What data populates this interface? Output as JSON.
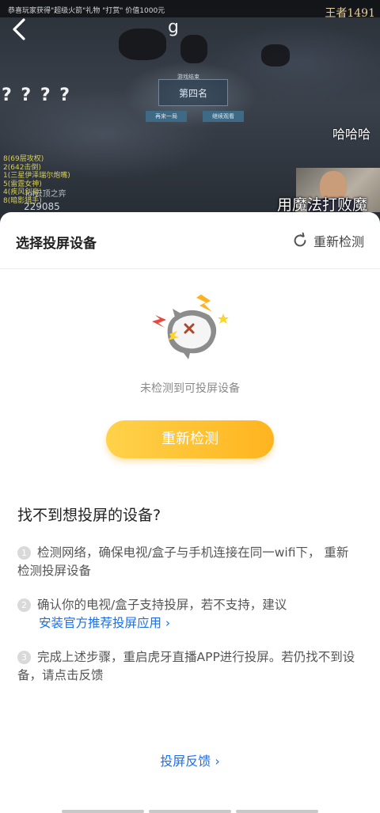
{
  "video": {
    "ticker": "恭喜玩家获得\"超级火箭\"礼物 \"打赏\" 价值1000元",
    "watermark": "王者1491",
    "back_icon": "chevron-left-icon",
    "letter": "g",
    "rank_sub": "游戏结束",
    "rank": "第四名",
    "btn_left": "再来一局",
    "btn_right": "继续观看",
    "question_marks": "? ? ? ?",
    "chat_lines": [
      "8(69层攻权)",
      "2(642击倒)",
      "1(三星伊泽瑞尔炮嘴)",
      "5(雷霆女神)",
      "4(疾风剑豪)",
      "8(暗影猎手)"
    ],
    "cloud_text": "lol云顶之弈",
    "number": "229085",
    "laugh": "哈哈哈",
    "caption": "用魔法打败魔"
  },
  "sheet": {
    "title": "选择投屏设备",
    "redetect_label": "重新检测",
    "refresh_icon": "refresh-icon",
    "mascot_icon": "broken-mascot-icon",
    "empty_text": "未检测到可投屏设备",
    "button_label": "重新检测",
    "help_title": "找不到想投屏的设备?",
    "steps": [
      {
        "num": "1",
        "text": "检测网络，确保电视/盒子与手机连接在同一wifi下， 重新检测投屏设备"
      },
      {
        "num": "2",
        "text": "确认你的电视/盒子支持投屏，若不支持，建议",
        "link": "安装官方推荐投屏应用 ›"
      },
      {
        "num": "3",
        "text": "完成上述步骤，重启虎牙直播APP进行投屏。若仍找不到设备，请点击反馈"
      }
    ],
    "feedback_label": "投屏反馈 ›"
  },
  "colors": {
    "accent_blue": "#1a6ff0",
    "button_yellow": "#ffc234"
  }
}
